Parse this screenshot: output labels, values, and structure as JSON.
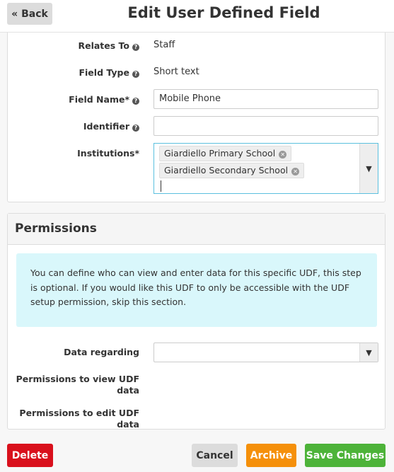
{
  "header": {
    "back_label": "« Back",
    "title": "Edit User Defined Field"
  },
  "details": {
    "relates_to": {
      "label": "Relates To",
      "value": "Staff"
    },
    "field_type": {
      "label": "Field Type",
      "value": "Short text"
    },
    "field_name": {
      "label": "Field Name*",
      "value": "Mobile Phone"
    },
    "identifier": {
      "label": "Identifier",
      "value": ""
    },
    "institutions": {
      "label": "Institutions*",
      "selected": [
        "Giardiello Primary School",
        "Giardiello Secondary School"
      ]
    },
    "help_glyph": "?",
    "remove_glyph": "✕",
    "arrow_glyph": "▼"
  },
  "permissions": {
    "title": "Permissions",
    "info": "You can define who can view and enter data for this specific UDF, this step is optional. If you would like this UDF to only be accessible with the UDF setup permission, skip this section.",
    "data_regarding_label": "Data regarding",
    "data_regarding_value": "",
    "view_label": "Permissions to view UDF data",
    "edit_label": "Permissions to edit UDF data"
  },
  "footer": {
    "delete_label": "Delete",
    "cancel_label": "Cancel",
    "archive_label": "Archive",
    "save_label": "Save Changes"
  },
  "colors": {
    "delete": "#d9101c",
    "archive": "#f5900a",
    "save": "#4db339",
    "info_bg": "#d9f7fb",
    "focus_border": "#5bc0de"
  }
}
